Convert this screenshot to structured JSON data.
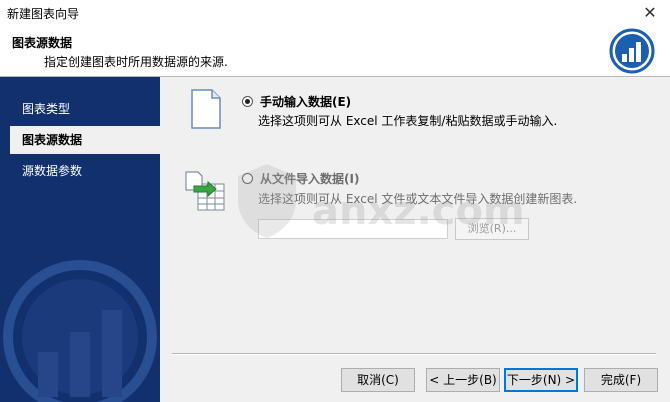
{
  "window": {
    "title": "新建图表向导"
  },
  "header": {
    "title": "图表源数据",
    "subtitle": "指定创建图表时所用数据源的来源."
  },
  "sidebar": {
    "items": [
      {
        "label": "图表类型"
      },
      {
        "label": "图表源数据"
      },
      {
        "label": "源数据参数"
      }
    ],
    "active_index": 1
  },
  "options": {
    "manual": {
      "label": "手动输入数据(E)",
      "description": "选择这项则可从 Excel 工作表复制/粘贴数据或手动输入.",
      "selected": true
    },
    "file": {
      "label": "从文件导入数据(I)",
      "description": "选择这项则可从 Excel 文件或文本文件导入数据创建新图表.",
      "selected": false,
      "path_value": "",
      "browse_label": "浏览(R)..."
    }
  },
  "watermark": {
    "text": "anxz.com"
  },
  "buttons": {
    "cancel": "取消(C)",
    "back": "< 上一步(B)",
    "next": "下一步(N) >",
    "finish": "完成(F)"
  },
  "colors": {
    "sidebar": "#12306e",
    "logo_ring": "#1b5fae",
    "accent": "#0078d7"
  }
}
